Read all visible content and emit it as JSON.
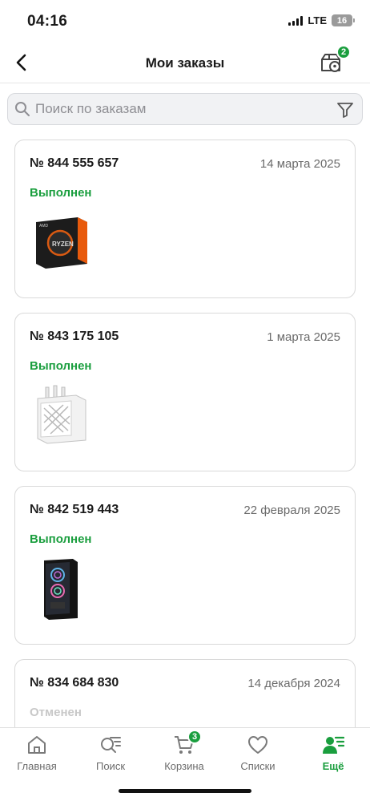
{
  "status_bar": {
    "time": "04:16",
    "network": "LTE",
    "battery": "16"
  },
  "nav": {
    "title": "Мои заказы",
    "tracking_badge": "2"
  },
  "search": {
    "placeholder": "Поиск по заказам"
  },
  "orders": [
    {
      "number": "№ 844 555 657",
      "date": "14 марта 2025",
      "status": "Выполнен",
      "product_icon": "cpu-box-image"
    },
    {
      "number": "№ 843 175 105",
      "date": "1 марта 2025",
      "status": "Выполнен",
      "product_icon": "power-supply-image"
    },
    {
      "number": "№ 842 519 443",
      "date": "22 февраля 2025",
      "status": "Выполнен",
      "product_icon": "pc-case-image"
    },
    {
      "number": "№ 834 684 830",
      "date": "14 декабря 2024",
      "status": "Отменен",
      "product_icon": ""
    }
  ],
  "tabs": [
    {
      "label": "Главная",
      "icon": "home-icon"
    },
    {
      "label": "Поиск",
      "icon": "search-list-icon"
    },
    {
      "label": "Корзина",
      "icon": "cart-icon",
      "badge": "3"
    },
    {
      "label": "Списки",
      "icon": "heart-icon"
    },
    {
      "label": "Ещё",
      "icon": "profile-menu-icon",
      "active": true
    }
  ],
  "colors": {
    "accent": "#1a9e3e",
    "muted": "#6b6b6b",
    "cancelled": "#c8c8c8"
  }
}
